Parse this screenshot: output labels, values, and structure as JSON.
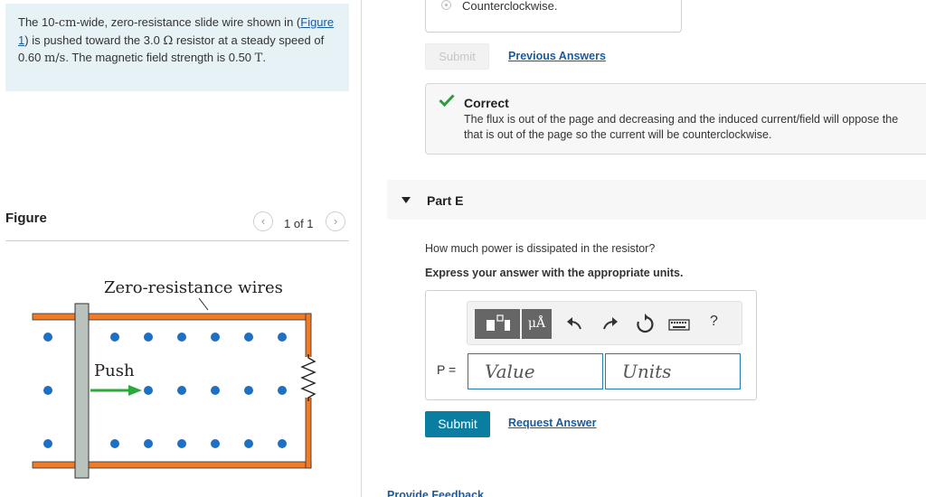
{
  "problem": {
    "text_1": "The 10-",
    "unit_cm": "cm",
    "text_2": "-wide, zero-resistance slide wire shown in",
    "figure_link": "Figure 1",
    "text_3": " is pushed toward the 3.0",
    "unit_ohm": "Ω",
    "text_4": " resistor at a steady speed of 0.60",
    "unit_speed": "m/s",
    "text_5": ". The magnetic field strength is 0.50",
    "unit_tesla": "T",
    "text_6": "."
  },
  "figure": {
    "title": "Figure",
    "pager": "1 of 1",
    "prev_icon": "chevron-left-icon",
    "next_icon": "chevron-right-icon",
    "label_wires": "Zero-resistance wires",
    "label_push": "Push",
    "colors": {
      "rail": "#f07a25",
      "slider": "#b9c2bd",
      "arrow": "#2aaa3a",
      "dots": "#1f6fc2"
    }
  },
  "previous_part": {
    "radio_label": "Counterclockwise.",
    "submit_label": "Submit",
    "previous_answers_link": "Previous Answers",
    "feedback_title": "Correct",
    "feedback_line1": "The flux is out of the page and decreasing and the induced current/field will oppose the",
    "feedback_line2": "that is out of the page so the current will be counterclockwise."
  },
  "part_e": {
    "title": "Part E",
    "question": "How much power is dissipated in the resistor?",
    "instructions": "Express your answer with the appropriate units.",
    "toolbar": {
      "template_icon": "template-icon",
      "units_label": "μÅ",
      "undo_icon": "undo-icon",
      "redo_icon": "redo-icon",
      "reset_icon": "reset-icon",
      "keyboard_icon": "keyboard-icon",
      "help_label": "?"
    },
    "variable_label": "P =",
    "value_placeholder": "Value",
    "units_placeholder": "Units",
    "submit_label": "Submit",
    "request_answer_link": "Request Answer"
  },
  "footer": {
    "provide_feedback_link": "Provide Feedback"
  }
}
